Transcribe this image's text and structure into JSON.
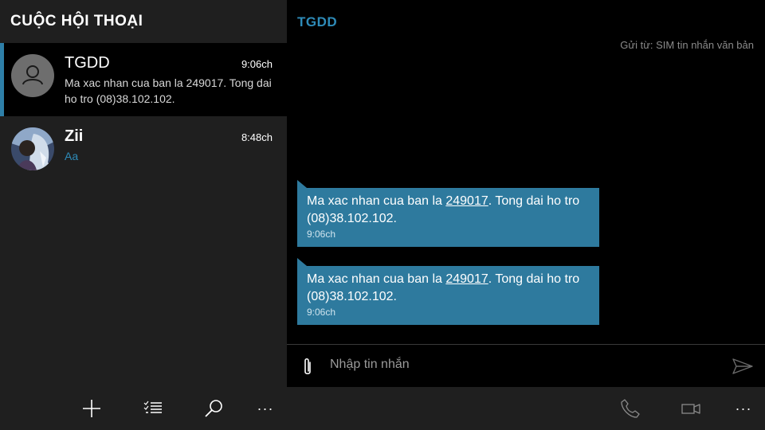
{
  "left": {
    "title": "CUỘC HỘI THOẠI",
    "conversations": [
      {
        "name": "TGDD",
        "time": "9:06ch",
        "snippet": "Ma xac nhan cua ban la 249017. Tong dai ho tro (08)38.102.102.",
        "avatar": "person-icon",
        "selected": true
      },
      {
        "name": "Zii",
        "time": "8:48ch",
        "snippet": "Aa",
        "avatar": "photo-avatar",
        "selected": false
      }
    ]
  },
  "thread": {
    "title": "TGDD",
    "send_from": "Gửi từ: SIM tin nhắn văn bản",
    "messages": [
      {
        "pre": "Ma xac nhan cua ban la ",
        "code": "249017",
        "post": ". Tong dai ho tro (08)38.102.102.",
        "time": "9:06ch"
      },
      {
        "pre": "Ma xac nhan cua ban la ",
        "code": "249017",
        "post": ". Tong dai ho tro (08)38.102.102.",
        "time": "9:06ch"
      }
    ],
    "compose_placeholder": "Nhập tin nhắn"
  },
  "appbar": {
    "left_buttons": [
      "add-icon",
      "select-list-icon",
      "search-icon",
      "more-icon"
    ],
    "right_buttons": [
      "phone-icon",
      "video-icon",
      "more-icon"
    ],
    "more_label": "···"
  },
  "colors": {
    "accent": "#2e8bb8",
    "bubble": "#2e7a9e",
    "pane": "#1f1f1f"
  }
}
